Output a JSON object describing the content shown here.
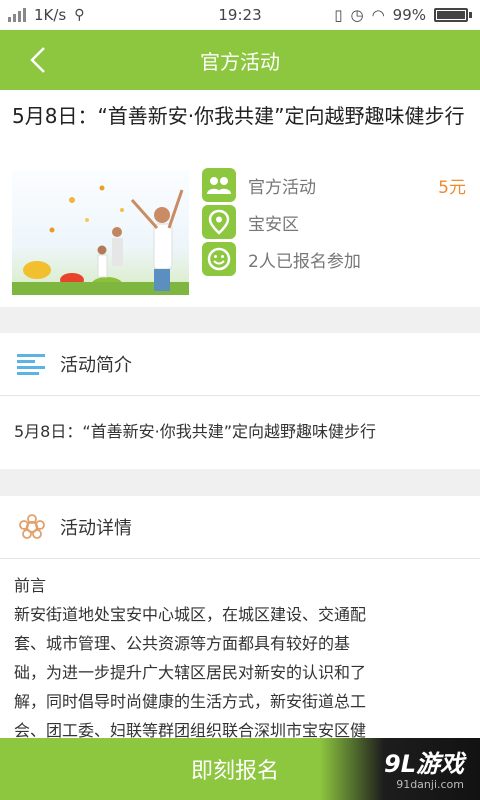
{
  "status_bar": {
    "speed": "1K/s",
    "time": "19:23",
    "battery": "99%"
  },
  "header": {
    "title": "官方活动"
  },
  "activity": {
    "title": "5月8日：“首善新安·你我共建”定向越野趣味健步行",
    "category": "官方活动",
    "price": "5元",
    "location": "宝安区",
    "participants": "2人已报名参加"
  },
  "intro": {
    "heading": "活动简介",
    "text": "5月8日：“首善新安·你我共建”定向越野趣味健步行"
  },
  "details": {
    "heading": "活动详情",
    "preface": "前言",
    "paragraph_lines": [
      "新安街道地处宝安中心城区，在城区建设、交通配",
      "套、城市管理、公共资源等方面都具有较好的基",
      "础，为进一步提升广大辖区居民对新安的认识和了",
      "解，同时倡导时尚健康的生活方式，新安街道总工",
      "会、团工委、妇联等群团组织联合深圳市宝安区健"
    ]
  },
  "action": {
    "signup_label": "即刻报名"
  },
  "watermark": {
    "logo": "9L游戏",
    "url": "91danji.com"
  },
  "colors": {
    "brand_green": "#8dc63f",
    "price_orange": "#f08a2c",
    "intro_icon_blue": "#5bb3e6",
    "details_icon_orange": "#e0a06a"
  }
}
